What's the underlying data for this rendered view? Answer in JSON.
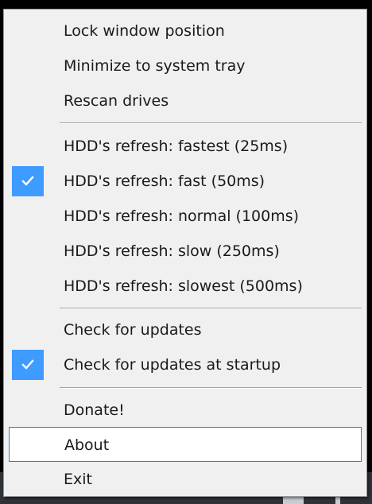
{
  "menu": {
    "items": [
      {
        "label": "Lock window position",
        "checked": false
      },
      {
        "label": "Minimize to system tray",
        "checked": false
      },
      {
        "label": "Rescan drives",
        "checked": false
      },
      {
        "label": "HDD's refresh: fastest (25ms)",
        "checked": false
      },
      {
        "label": "HDD's refresh: fast (50ms)",
        "checked": true
      },
      {
        "label": "HDD's refresh: normal (100ms)",
        "checked": false
      },
      {
        "label": "HDD's refresh: slow (250ms)",
        "checked": false
      },
      {
        "label": "HDD's refresh: slowest (500ms)",
        "checked": false
      },
      {
        "label": "Check for updates",
        "checked": false
      },
      {
        "label": "Check for updates at startup",
        "checked": true
      },
      {
        "label": "Donate!",
        "checked": false
      },
      {
        "label": "About",
        "checked": false,
        "highlighted": true
      },
      {
        "label": "Exit",
        "checked": false
      }
    ]
  },
  "colors": {
    "menu_background": "#f0f0f0",
    "check_background": "#3e9bff",
    "highlight_border": "#3c7fb1"
  }
}
